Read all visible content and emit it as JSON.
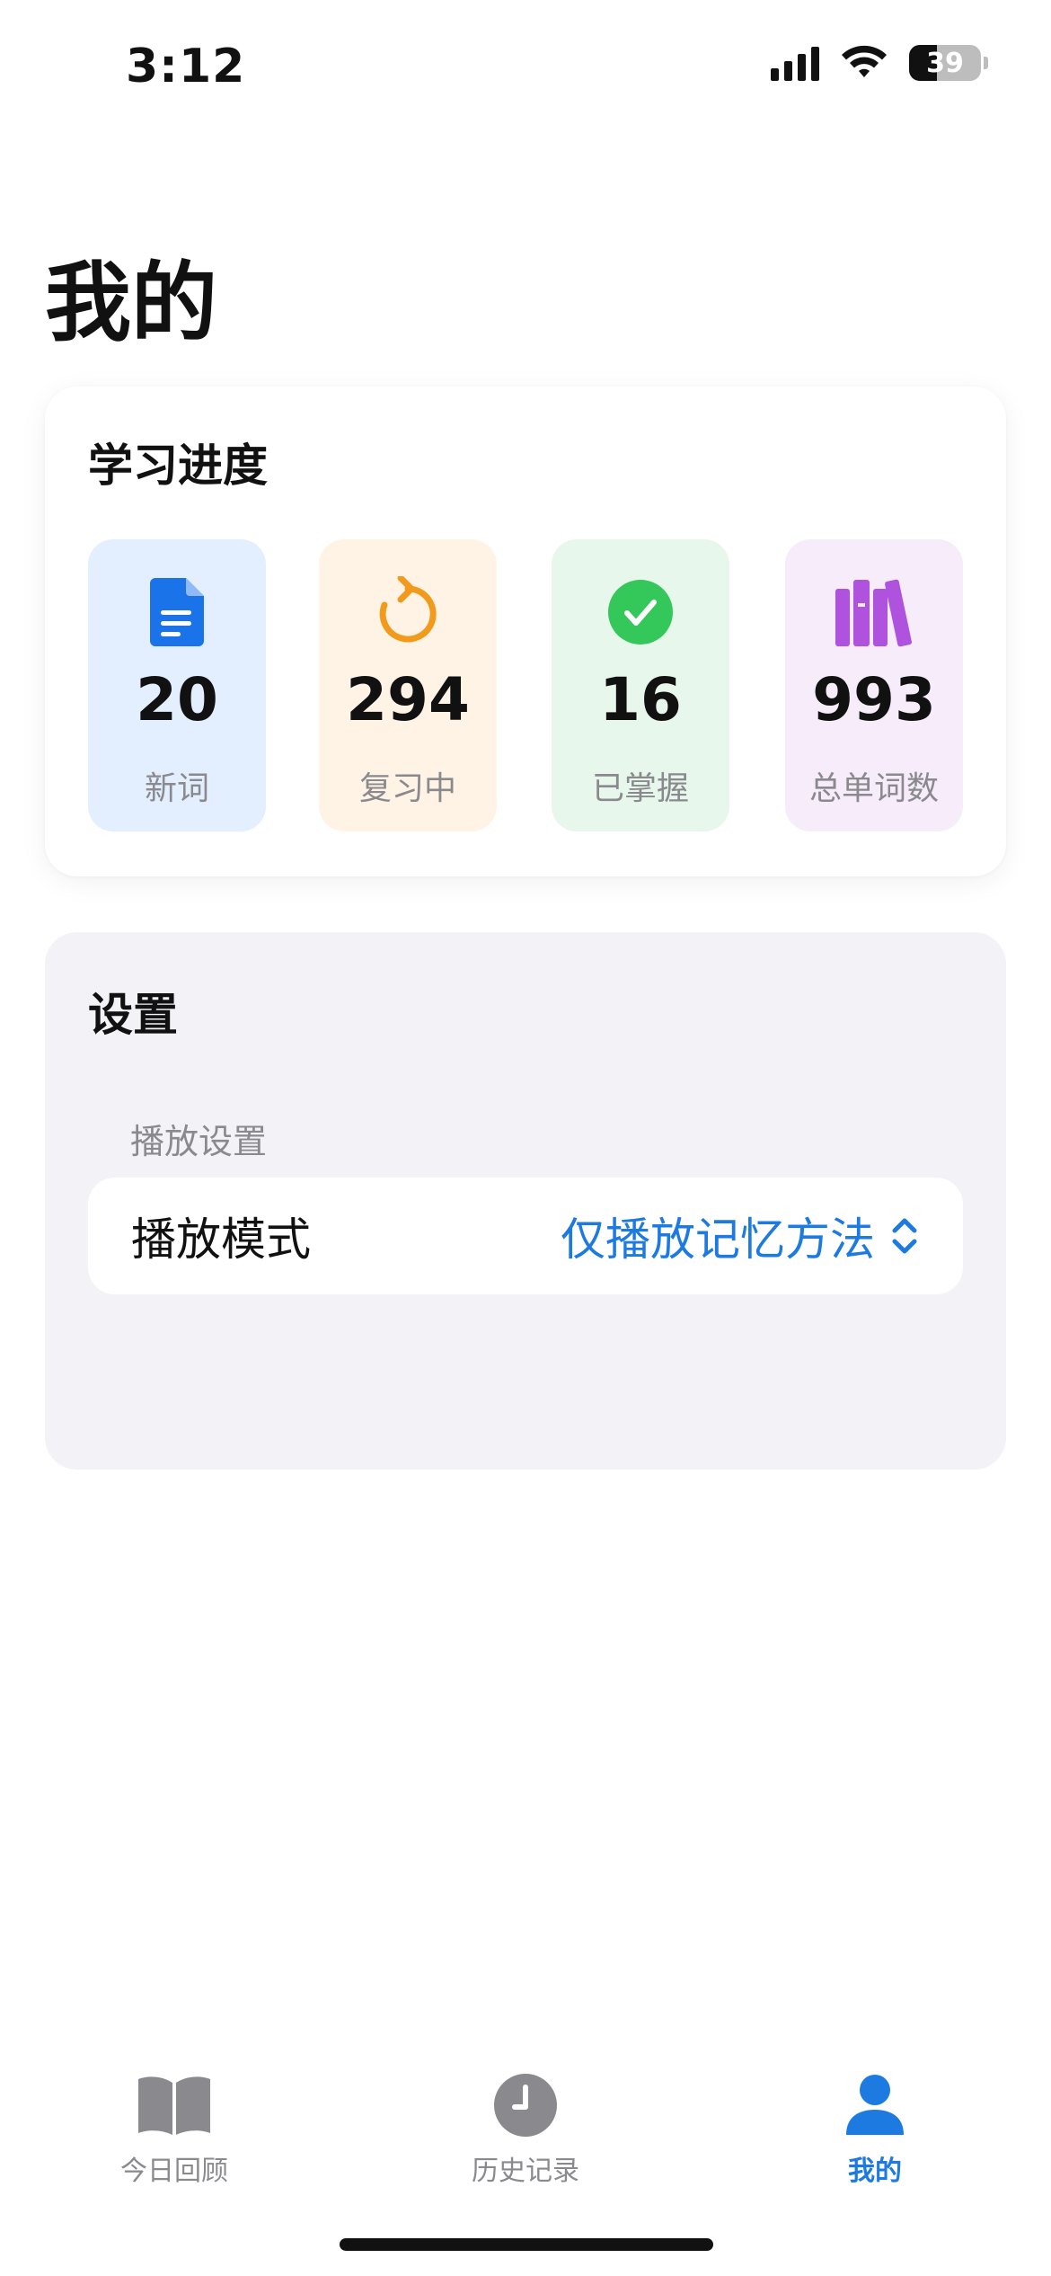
{
  "status_bar": {
    "time": "3:12",
    "battery_level": "39",
    "battery_fraction": 0.39
  },
  "page": {
    "title": "我的"
  },
  "progress": {
    "title": "学习进度",
    "stats": [
      {
        "value": "20",
        "label": "新词",
        "icon": "document-icon",
        "bg": "#e3efff",
        "icon_color": "#1a73e8"
      },
      {
        "value": "294",
        "label": "复习中",
        "icon": "refresh-icon",
        "bg": "#fff3e6",
        "icon_color": "#f29a1b"
      },
      {
        "value": "16",
        "label": "已掌握",
        "icon": "checkmark-circle-icon",
        "bg": "#e8f7ec",
        "icon_color": "#34c759"
      },
      {
        "value": "993",
        "label": "总单词数",
        "icon": "books-icon",
        "bg": "#f6ecfa",
        "icon_color": "#af52de"
      }
    ]
  },
  "settings": {
    "title": "设置",
    "section_label": "播放设置",
    "play_mode": {
      "label": "播放模式",
      "value": "仅播放记忆方法"
    }
  },
  "tab_bar": {
    "items": [
      {
        "label": "今日回顾",
        "icon": "book-open-icon",
        "active": false
      },
      {
        "label": "历史记录",
        "icon": "clock-icon",
        "active": false
      },
      {
        "label": "我的",
        "icon": "person-icon",
        "active": true
      }
    ],
    "active_color": "#1d7ae0",
    "inactive_color": "#8a8a8e"
  }
}
